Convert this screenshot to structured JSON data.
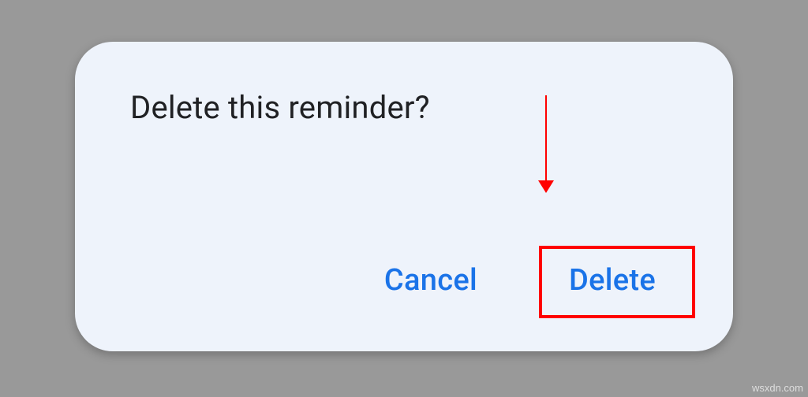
{
  "dialog": {
    "title": "Delete this reminder?",
    "cancel_label": "Cancel",
    "delete_label": "Delete"
  },
  "annotation": {
    "arrow_target": "delete-button",
    "highlight_target": "delete-button"
  },
  "watermark": "wsxdn.com"
}
